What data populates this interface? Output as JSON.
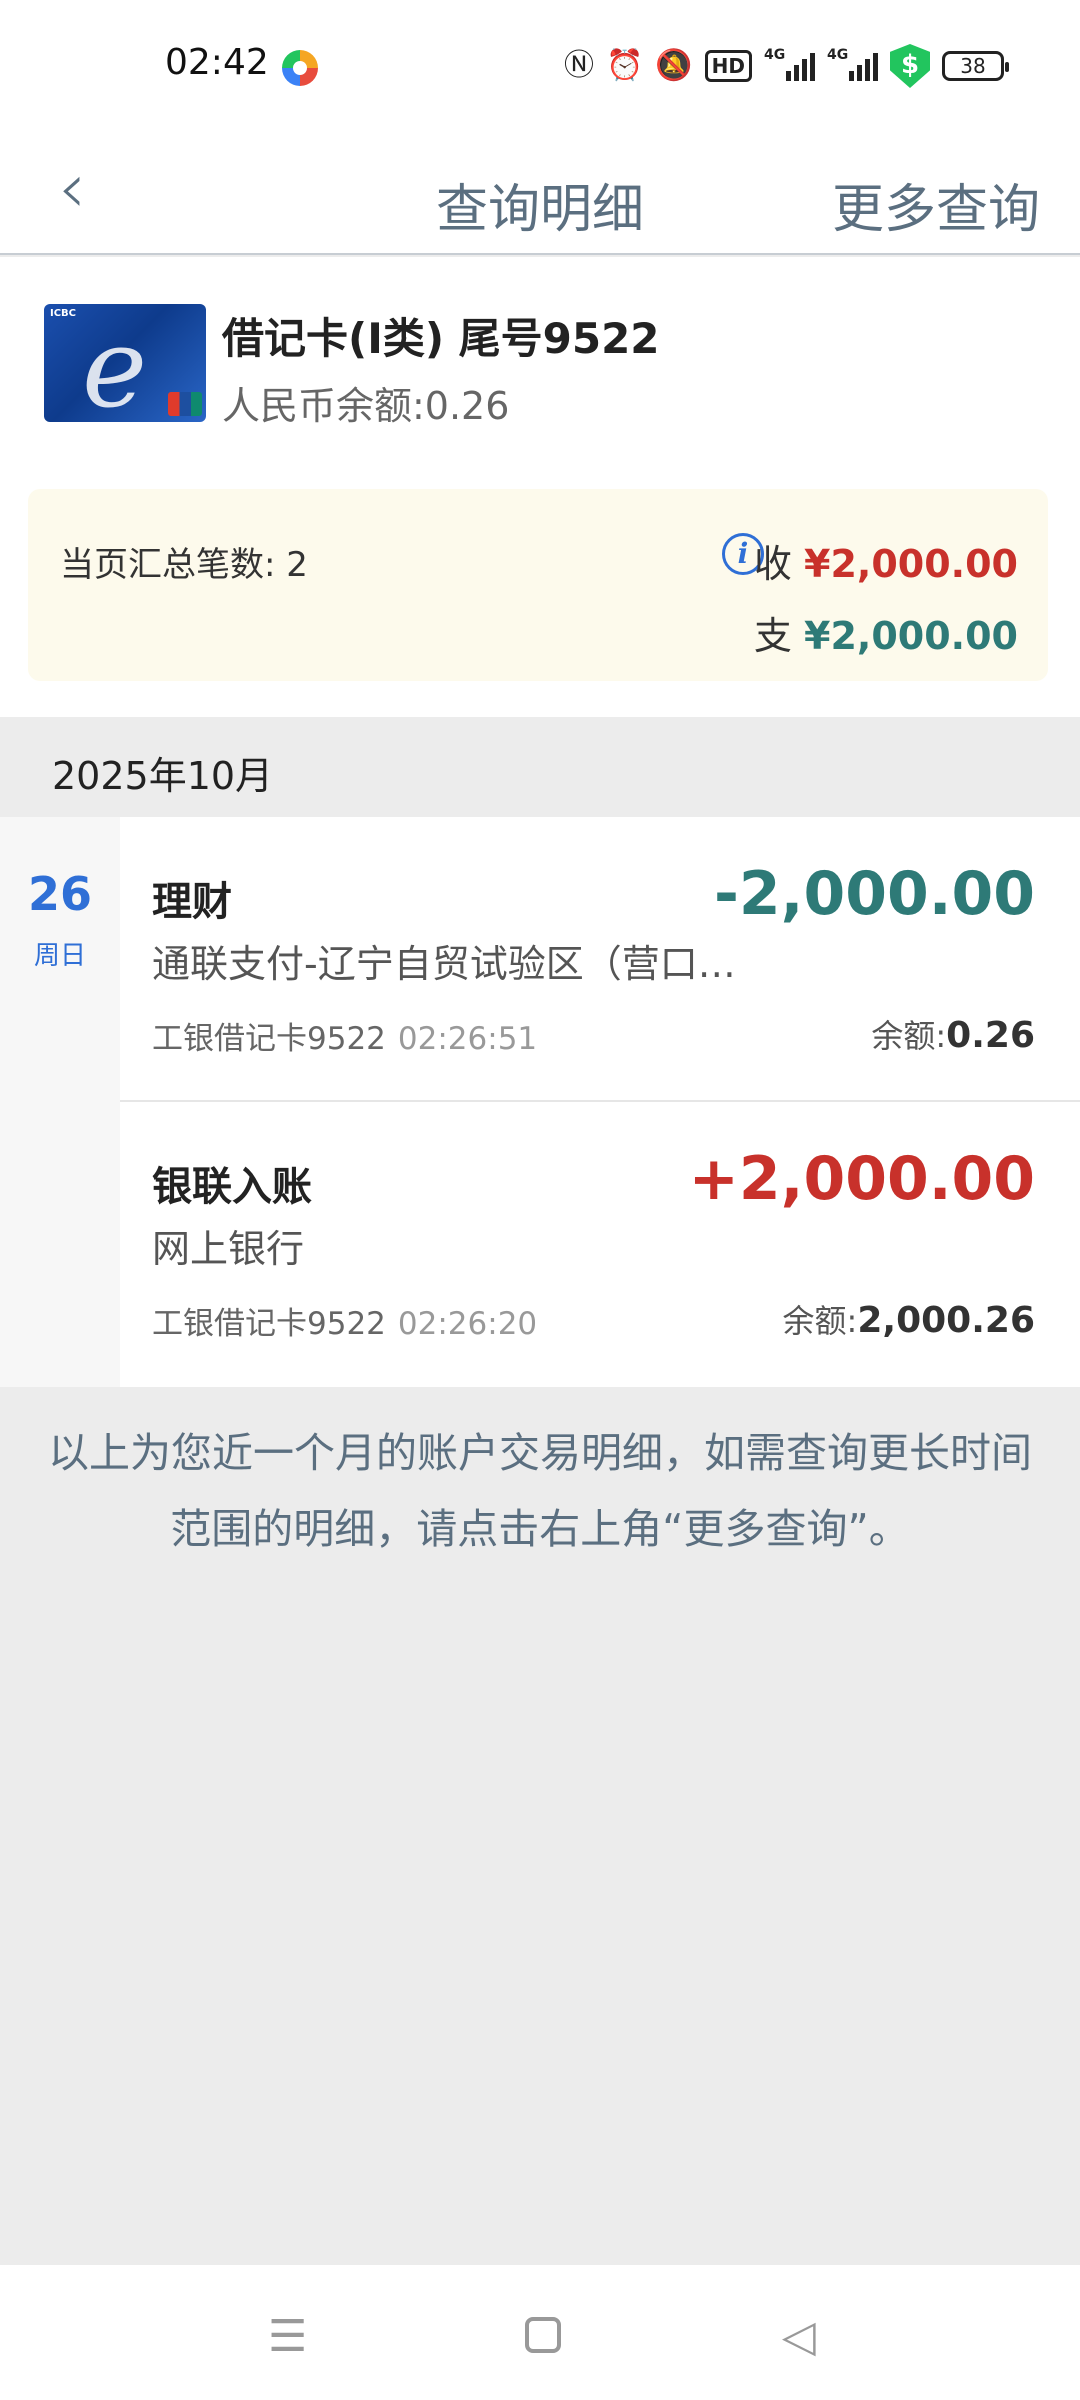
{
  "status_bar": {
    "time": "02:42",
    "hd_label": "HD",
    "net1": "4G",
    "net2": "4G",
    "battery": "38",
    "shield_symbol": "$"
  },
  "nav": {
    "back_icon": "chevron-left",
    "title": "查询明细",
    "more": "更多查询"
  },
  "card": {
    "name": "借记卡(I类) 尾号9522",
    "balance": "人民币余额:0.26"
  },
  "summary": {
    "count": "当页汇总笔数: 2",
    "in_label": "收",
    "in_amount": "¥2,000.00",
    "out_label": "支",
    "out_amount": "¥2,000.00"
  },
  "month": "2025年10月",
  "date": {
    "day": "26",
    "weekday": "周日"
  },
  "transactions": [
    {
      "title": "理财",
      "desc": "通联支付-辽宁自贸试验区（营口片区）",
      "amount": "-2,000.00",
      "card": "工银借记卡9522",
      "time": "02:26:51",
      "balance_label": "余额:",
      "balance": "0.26"
    },
    {
      "title": "银联入账",
      "desc": "网上银行",
      "amount": "+2,000.00",
      "card": "工银借记卡9522",
      "time": "02:26:20",
      "balance_label": "余额:",
      "balance": "2,000.26"
    }
  ],
  "notice": "以上为您近一个月的账户交易明细，如需查询更长时间范围的明细，请点击右上角“更多查询”。",
  "colors": {
    "expense": "#2e7a77",
    "income": "#c8312b",
    "date_accent": "#2f6fd6"
  }
}
